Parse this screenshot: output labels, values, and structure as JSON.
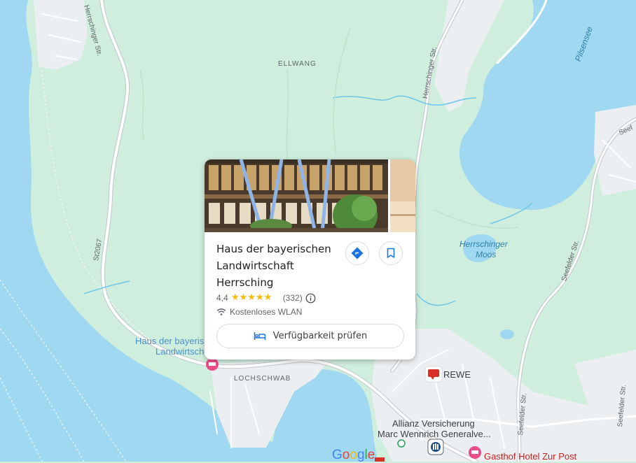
{
  "map": {
    "labels": {
      "ellwang": "ELLWANG",
      "lochschwab": "LOCHSCHWAB",
      "pilsensee": "Pilsensee",
      "herrschinger_moos": [
        "Herrschinger",
        "Moos"
      ],
      "st2067": "St2067",
      "herrschinger_str_left": "Herrschinger Str.",
      "herrschinger_str_right": "Herrschinger Str.",
      "seefelder_str_1": "Seefelder Str.",
      "seefelder_str_2": "Seefelder Str.",
      "seefelder_str_3": "Seefelder Str.",
      "seef": "Seef",
      "hotel_map_label": [
        "Haus der bayeris",
        "Landwirtsch"
      ],
      "rewe": "REWE",
      "allianz": [
        "Allianz Versicherung",
        "Marc Wennrich Generalve..."
      ],
      "gasthof": "Gasthof Hotel Zur Post",
      "google": "Google"
    },
    "colors": {
      "water": "#9fd8f0",
      "land": "#cfeedd",
      "urban": "#eceff1",
      "road": "#ffffff",
      "road_outline": "#c0c6cc"
    }
  },
  "card": {
    "title_lines": [
      "Haus der bayerischen",
      "Landwirtschaft",
      "Herrsching"
    ],
    "rating": "4,4",
    "rating_fraction": 0.88,
    "review_count": "(332)",
    "amenity": "Kostenloses WLAN",
    "check_button": "Verfügbarkeit prüfen",
    "directions_icon": "directions-icon",
    "save_icon": "bookmark-icon",
    "accent": "#1a73e8"
  }
}
